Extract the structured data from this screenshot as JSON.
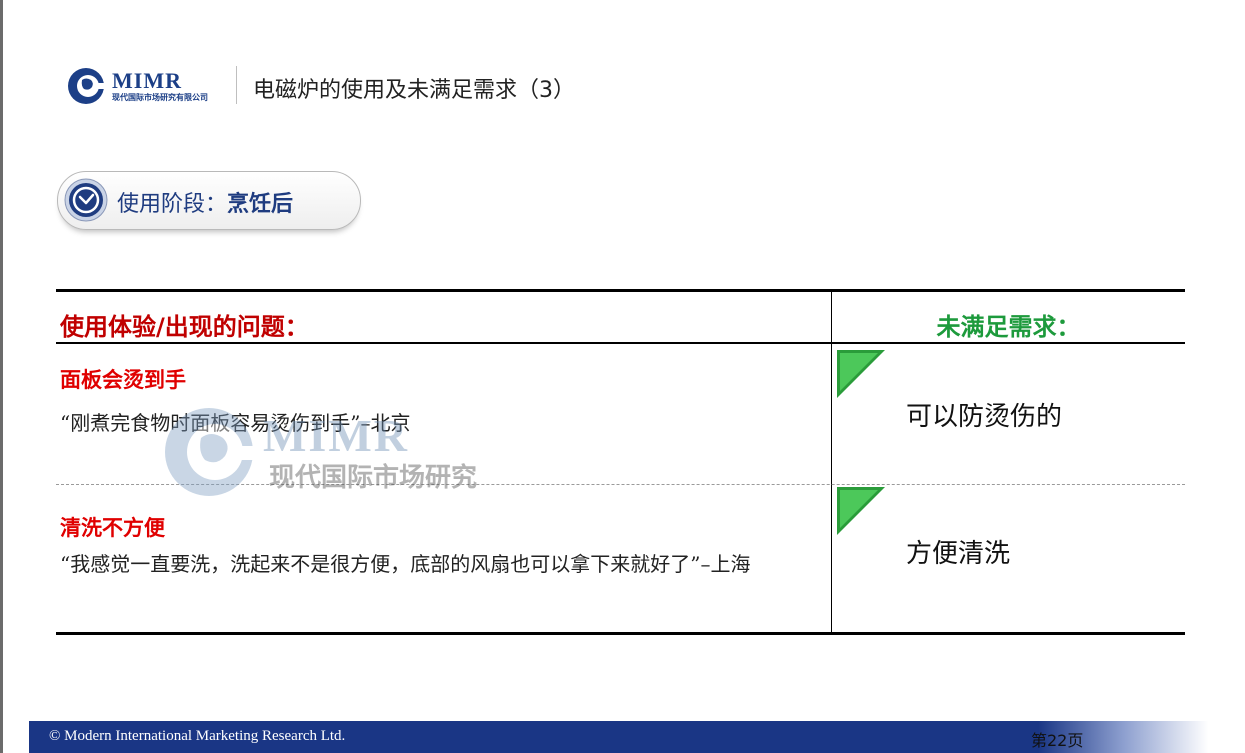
{
  "header": {
    "logo_text": "MIMR",
    "logo_subtitle": "现代国际市场研究有限公司",
    "title": "电磁炉的使用及未满足需求（3）"
  },
  "stage": {
    "label": "使用阶段：",
    "value": "烹饪后",
    "icon": "clock-icon"
  },
  "table": {
    "header_left": "使用体验/出现的问题：",
    "header_right": "未满足需求：",
    "rows": [
      {
        "issue_title": "面板会烫到手",
        "quote": "“刚煮完食物时面板容易烫伤到手”–北京",
        "need": "可以防烫伤的"
      },
      {
        "issue_title": "清洗不方便",
        "quote": "“我感觉一直要洗，洗起来不是很方便，底部的风扇也可以拿下来就好了”–上海",
        "need": "方便清洗"
      }
    ]
  },
  "watermark": {
    "latin": "MIMR",
    "chinese": "现代国际市场研究"
  },
  "footer": {
    "copyright": "© Modern International Marketing Research Ltd.",
    "page": "第22页"
  },
  "colors": {
    "brand_blue": "#1c3f87",
    "issue_red": "#e00000",
    "need_green": "#1d9a3c",
    "footer_bar": "#1a3685"
  }
}
